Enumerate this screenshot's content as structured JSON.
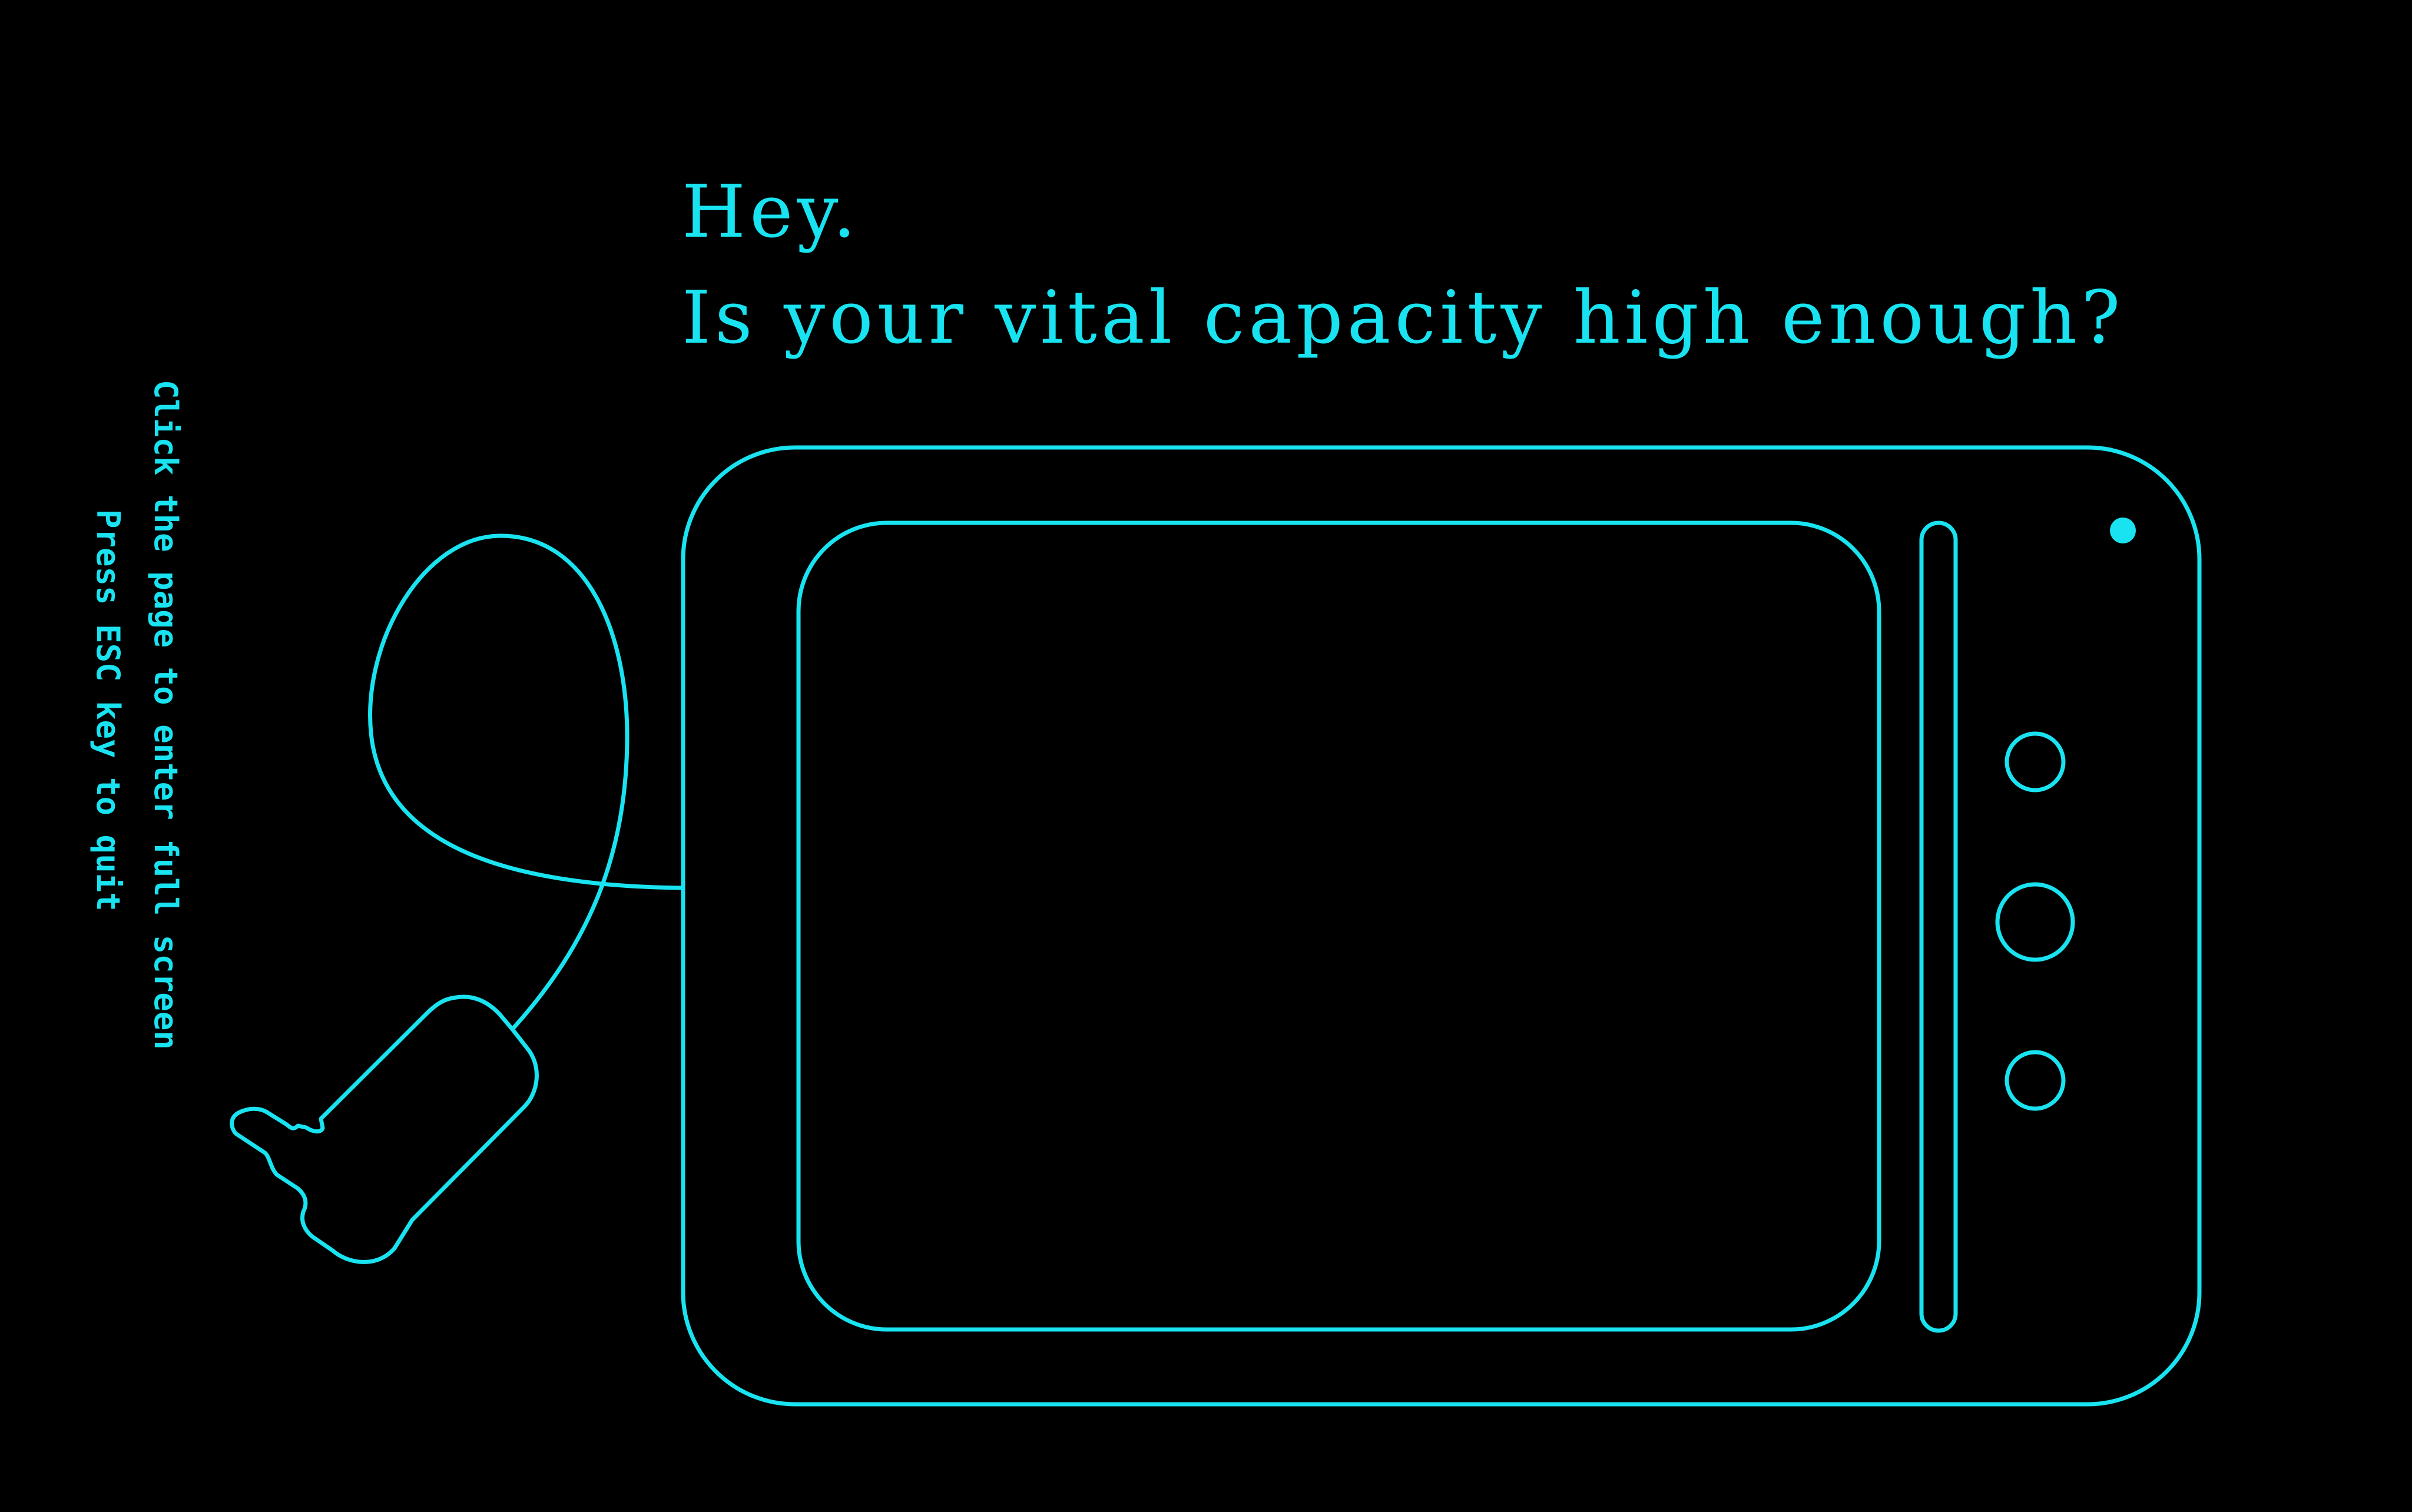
{
  "headline": {
    "greeting": "Hey.",
    "question": "Is your vital capacity high enough?"
  },
  "hints": {
    "quit": "Press ESC key to quit",
    "fullscreen": "Click the page to enter full screen"
  },
  "colors": {
    "accent": "#19e3f0",
    "background": "#000000"
  },
  "icons": {
    "mouthpiece": "mouthpiece-icon",
    "tube": "breathing-tube",
    "indicator": "indicator-light"
  }
}
